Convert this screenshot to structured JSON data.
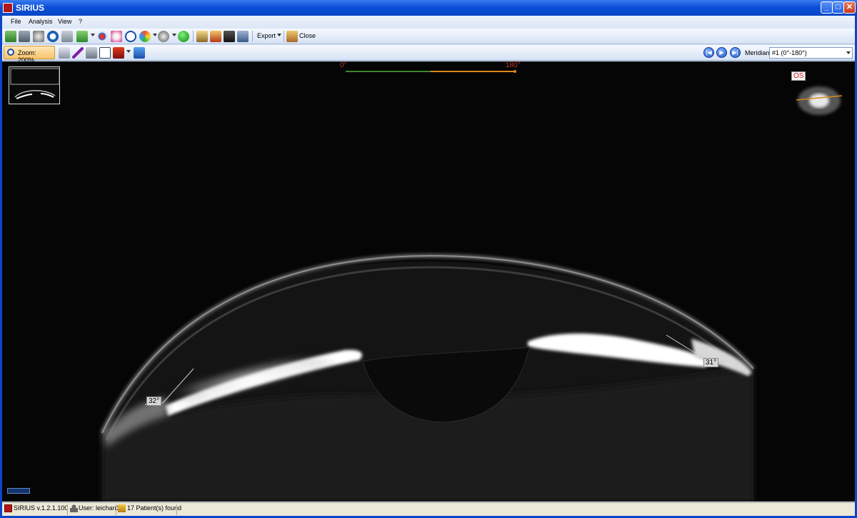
{
  "window": {
    "title": "SIRIUS",
    "controls": [
      "minimize",
      "maximize",
      "close"
    ]
  },
  "menu": {
    "items": [
      "File",
      "Analysis",
      "View",
      "?"
    ]
  },
  "toolbar1": {
    "export_label": "Export",
    "close_label": "Close"
  },
  "toolbar2": {
    "zoom_label": "Zoom: 200%",
    "meridian_label": "Meridian",
    "meridian_value": "#1 (0°-180°)"
  },
  "viewer": {
    "scale_start": "0°",
    "scale_end": "180°",
    "angle_left": "32°",
    "angle_right": "31°",
    "eye_label": "OS"
  },
  "statusbar": {
    "version": "SIRIUS  v.1.2.1.100",
    "user": "User: leichan1",
    "patients": "17 Patient(s) found"
  },
  "colors": {
    "titlebar": "#0b4fd9",
    "toolbar": "#d6e2f4",
    "viewer_bg": "#050505",
    "scale_green": "#3a8a2a",
    "scale_orange": "#d98a1a",
    "label_red": "#c0342a"
  },
  "icons": {
    "app": "sirius-logo-icon",
    "zoom": "magnifier-icon",
    "nav_prev": "skip-back-icon",
    "nav_play": "play-icon",
    "nav_next": "skip-forward-icon"
  }
}
